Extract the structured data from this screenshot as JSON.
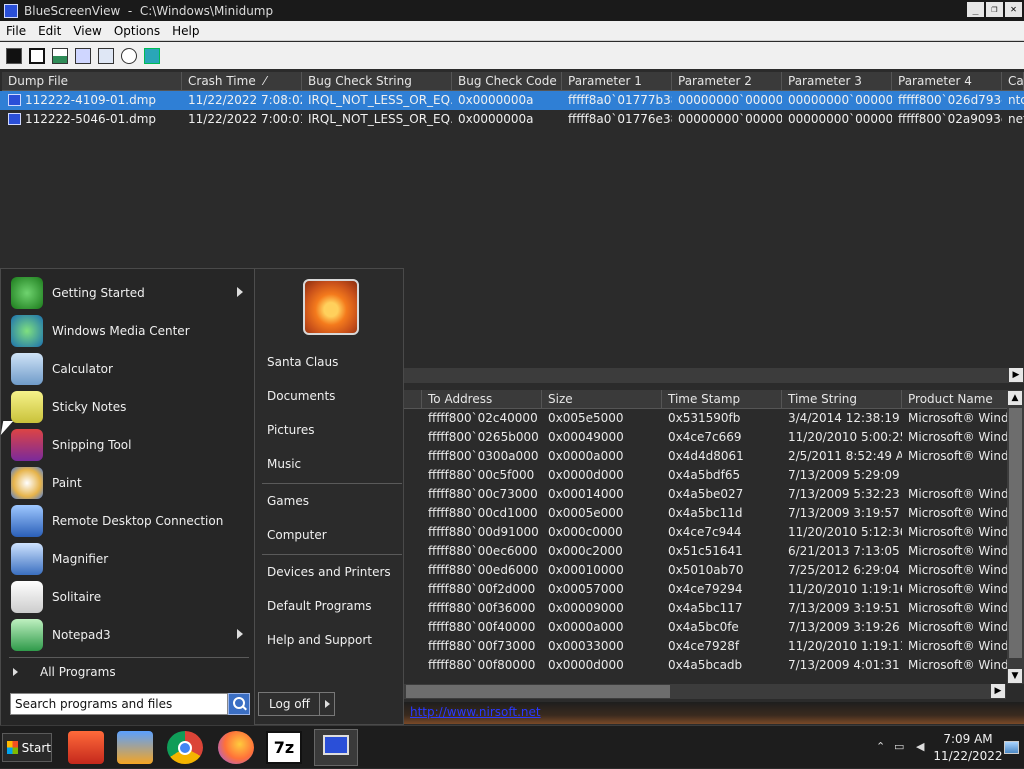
{
  "window": {
    "title": "BlueScreenView  -  C:\\Windows\\Minidump",
    "buttons": [
      "_",
      "❐",
      "✕"
    ]
  },
  "menubar": [
    "File",
    "Edit",
    "View",
    "Options",
    "Help"
  ],
  "toolbar_icons": [
    "save-icon",
    "save-all-icon",
    "html-report-icon",
    "copy-icon",
    "properties-icon",
    "find-icon",
    "exit-icon"
  ],
  "upper_table": {
    "columns": [
      "Dump File",
      "Crash Time",
      "Bug Check String",
      "Bug Check Code",
      "Parameter 1",
      "Parameter 2",
      "Parameter 3",
      "Parameter 4",
      "Ca"
    ],
    "sort_indicator": "⁄",
    "rows": [
      {
        "selected": true,
        "cells": [
          "112222-4109-01.dmp",
          "11/22/2022 7:08:02...",
          "IRQL_NOT_LESS_OR_EQ...",
          "0x0000000a",
          "fffff8a0`01777b38",
          "00000000`000000...",
          "00000000`000000...",
          "fffff800`026d793c",
          "ntc"
        ]
      },
      {
        "selected": false,
        "cells": [
          "112222-5046-01.dmp",
          "11/22/2022 7:00:01...",
          "IRQL_NOT_LESS_OR_EQ...",
          "0x0000000a",
          "fffff8a0`01776e38",
          "00000000`000000...",
          "00000000`000000...",
          "fffff800`02a9093c",
          "net"
        ]
      }
    ]
  },
  "lower_table": {
    "columns": [
      "To Address",
      "Size",
      "Time Stamp",
      "Time String",
      "Product Name"
    ],
    "rows": [
      [
        "fffff800`02c40000",
        "0x005e5000",
        "0x531590fb",
        "3/4/2014 12:38:19 ...",
        "Microsoft® Wind..."
      ],
      [
        "fffff800`0265b000",
        "0x00049000",
        "0x4ce7c669",
        "11/20/2010 5:00:25...",
        "Microsoft® Wind..."
      ],
      [
        "fffff800`0300a000",
        "0x0000a000",
        "0x4d4d8061",
        "2/5/2011 8:52:49 AM",
        "Microsoft® Wind..."
      ],
      [
        "fffff880`00c5f000",
        "0x0000d000",
        "0x4a5bdf65",
        "7/13/2009 5:29:09 ...",
        ""
      ],
      [
        "fffff880`00c73000",
        "0x00014000",
        "0x4a5be027",
        "7/13/2009 5:32:23 ...",
        "Microsoft® Wind..."
      ],
      [
        "fffff880`00cd1000",
        "0x0005e000",
        "0x4a5bc11d",
        "7/13/2009 3:19:57 ...",
        "Microsoft® Wind..."
      ],
      [
        "fffff880`00d91000",
        "0x000c0000",
        "0x4ce7c944",
        "11/20/2010 5:12:36...",
        "Microsoft® Wind..."
      ],
      [
        "fffff880`00ec6000",
        "0x000c2000",
        "0x51c51641",
        "6/21/2013 7:13:05 ...",
        "Microsoft® Wind..."
      ],
      [
        "fffff880`00ed6000",
        "0x00010000",
        "0x5010ab70",
        "7/25/2012 6:29:04 ...",
        "Microsoft® Wind..."
      ],
      [
        "fffff880`00f2d000",
        "0x00057000",
        "0x4ce79294",
        "11/20/2010 1:19:16...",
        "Microsoft® Wind..."
      ],
      [
        "fffff880`00f36000",
        "0x00009000",
        "0x4a5bc117",
        "7/13/2009 3:19:51 ...",
        "Microsoft® Wind..."
      ],
      [
        "fffff880`00f40000",
        "0x0000a000",
        "0x4a5bc0fe",
        "7/13/2009 3:19:26 ...",
        "Microsoft® Wind..."
      ],
      [
        "fffff880`00f73000",
        "0x00033000",
        "0x4ce7928f",
        "11/20/2010 1:19:11...",
        "Microsoft® Wind..."
      ],
      [
        "fffff880`00f80000",
        "0x0000d000",
        "0x4a5bcadb",
        "7/13/2009 4:01:31 ...",
        "Microsoft® Wind..."
      ]
    ]
  },
  "statusbar": {
    "link": "http://www.nirsoft.net"
  },
  "start_menu": {
    "pinned": [
      {
        "label": "Getting Started",
        "icon": "getting-started-icon",
        "arrow": true
      },
      {
        "label": "Windows Media Center",
        "icon": "media-center-icon",
        "arrow": false
      },
      {
        "label": "Calculator",
        "icon": "calculator-icon",
        "arrow": false
      },
      {
        "label": "Sticky Notes",
        "icon": "sticky-notes-icon",
        "arrow": false
      },
      {
        "label": "Snipping Tool",
        "icon": "snipping-tool-icon",
        "arrow": false
      },
      {
        "label": "Paint",
        "icon": "paint-icon",
        "arrow": false
      },
      {
        "label": "Remote Desktop Connection",
        "icon": "remote-desktop-icon",
        "arrow": false
      },
      {
        "label": "Magnifier",
        "icon": "magnifier-icon",
        "arrow": false
      },
      {
        "label": "Solitaire",
        "icon": "solitaire-icon",
        "arrow": false
      },
      {
        "label": "Notepad3",
        "icon": "notepad-icon",
        "arrow": true
      }
    ],
    "all_programs": "All Programs",
    "search_placeholder": "Search programs and files",
    "right": [
      "Santa Claus",
      "Documents",
      "Pictures",
      "Music",
      "Games",
      "Computer",
      "Devices and Printers",
      "Default Programs",
      "Help and Support"
    ],
    "log_off": "Log off"
  },
  "taskbar": {
    "start_label": "Start",
    "apps": [
      "file-manager-icon",
      "media-player-icon",
      "chrome-icon",
      "firefox-icon",
      "7zip-icon",
      "bluescreenview-icon"
    ],
    "tray_icons": [
      "show-hidden-icon",
      "network-icon",
      "volume-icon"
    ],
    "time": "7:09 AM",
    "date": "11/22/2022"
  },
  "colors": {
    "selection": "#2f7fd5",
    "link": "#2a39ff"
  }
}
